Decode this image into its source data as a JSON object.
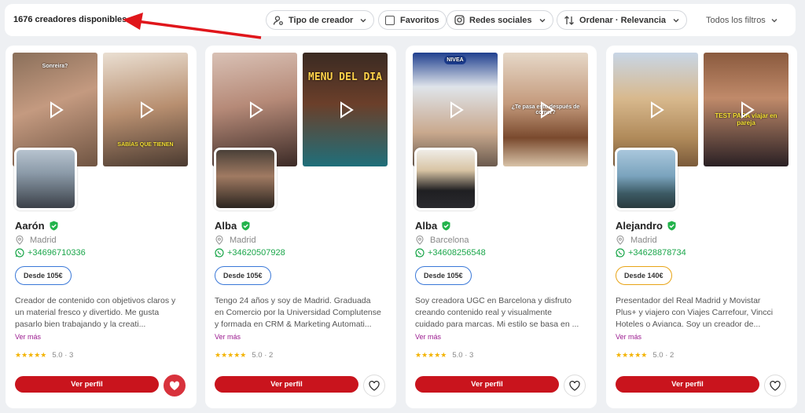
{
  "header": {
    "count_label": "1676 creadores disponibles",
    "filters": {
      "creator_type": "Tipo de creador",
      "favorites": "Favoritos",
      "social": "Redes sociales",
      "sort": "Ordenar · Relevancia",
      "all_filters": "Todos los filtros"
    }
  },
  "colors": {
    "brand_red": "#c9141d",
    "whatsapp_green": "#1aa64a",
    "verified_green": "#22b34b",
    "link_purple": "#9b1a8f",
    "star_yellow": "#f3b300"
  },
  "cards": [
    {
      "name": "Aarón",
      "city": "Madrid",
      "phone": "+34696710336",
      "price": "Desde 105€",
      "price_color": "#3a78d8",
      "bio": "Creador de contenido con objetivos claros y un material fresco y divertido. Me gusta pasarlo bien trabajando y la creati...",
      "more": "Ver más",
      "stars": "★★★★★",
      "rating": "5.0 · 3",
      "button": "Ver perfil",
      "favorite": true,
      "video1_caption": "Sonreira?",
      "video2_caption": "SABÍAS QUE TIENEN"
    },
    {
      "name": "Alba",
      "city": "Madrid",
      "phone": "+34620507928",
      "price": "Desde 105€",
      "price_color": "#3a78d8",
      "bio": "Tengo 24 años y soy de Madrid. Graduada en Comercio por la Universidad Complutense y formada en CRM & Marketing Automati...",
      "more": "Ver más",
      "stars": "★★★★★",
      "rating": "5.0 · 2",
      "button": "Ver perfil",
      "favorite": false,
      "video1_caption": "",
      "video2_caption": "MENU DEL DIA"
    },
    {
      "name": "Alba",
      "city": "Barcelona",
      "phone": "+34608256548",
      "price": "Desde 105€",
      "price_color": "#3a78d8",
      "bio": "Soy creadora UGC en Barcelona y disfruto creando contenido real y visualmente cuidado para marcas. Mi estilo se basa en ...",
      "more": "Ver más",
      "stars": "★★★★★",
      "rating": "5.0 · 3",
      "button": "Ver perfil",
      "favorite": false,
      "video1_caption": "NIVEA",
      "video2_caption": "¿Te pasa esto después de comer?"
    },
    {
      "name": "Alejandro",
      "city": "Madrid",
      "phone": "+34628878734",
      "price": "Desde 140€",
      "price_color": "#e8a416",
      "bio": "Presentador del Real Madrid y Movistar Plus+ y viajero con Viajes Carrefour, Vincci Hoteles o Avianca. Soy un creador de...",
      "more": "Ver más",
      "stars": "★★★★★",
      "rating": "5.0 · 2",
      "button": "Ver perfil",
      "favorite": false,
      "video1_caption": "",
      "video2_caption": "TEST PARA viajar en pareja"
    }
  ]
}
